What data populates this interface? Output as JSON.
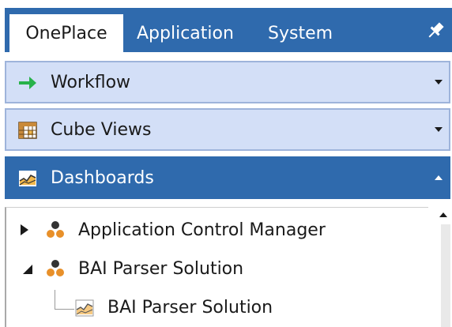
{
  "tabs": [
    {
      "label": "OnePlace",
      "active": true
    },
    {
      "label": "Application",
      "active": false
    },
    {
      "label": "System",
      "active": false
    }
  ],
  "sections": [
    {
      "label": "Workflow",
      "icon": "arrow-right-icon",
      "state": "collapsed"
    },
    {
      "label": "Cube Views",
      "icon": "grid-icon",
      "state": "collapsed"
    },
    {
      "label": "Dashboards",
      "icon": "chart-icon",
      "state": "expanded"
    }
  ],
  "tree": [
    {
      "label": "Application Control Manager",
      "icon": "dashboard-group-icon",
      "state": "collapsed"
    },
    {
      "label": "BAI Parser Solution",
      "icon": "dashboard-group-icon",
      "state": "expanded"
    },
    {
      "label": "BAI Parser Solution",
      "icon": "chart-icon",
      "state": "leaf"
    }
  ],
  "colors": {
    "accent": "#2f6aad",
    "section_bg": "#d3dff7",
    "section_border": "#9eb4db",
    "orange": "#e8902a",
    "dark_node": "#333333",
    "green_arrow": "#27b24a"
  }
}
